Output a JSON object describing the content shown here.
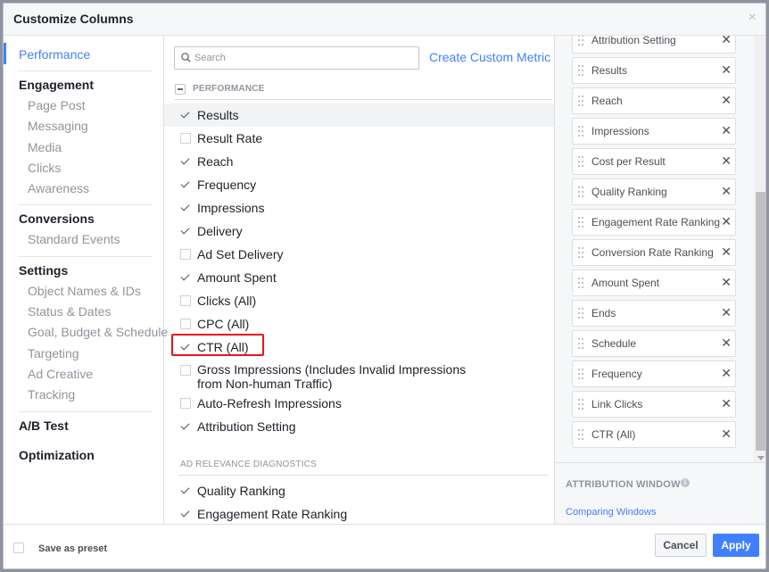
{
  "dialog": {
    "title": "Customize Columns",
    "close_icon": "×"
  },
  "nav": {
    "sections": [
      {
        "label": "Performance",
        "active": true,
        "items": []
      },
      {
        "label": "Engagement",
        "items": [
          "Page Post",
          "Messaging",
          "Media",
          "Clicks",
          "Awareness"
        ]
      },
      {
        "label": "Conversions",
        "items": [
          "Standard Events"
        ]
      },
      {
        "label": "Settings",
        "items": [
          "Object Names & IDs",
          "Status & Dates",
          "Goal, Budget & Schedule",
          "Targeting",
          "Ad Creative",
          "Tracking"
        ]
      },
      {
        "label": "A/B Test",
        "items": []
      },
      {
        "label": "Optimization",
        "items": []
      }
    ]
  },
  "search": {
    "placeholder": "Search",
    "value": ""
  },
  "create_custom_metric": "Create Custom Metric",
  "performance": {
    "heading": "PERFORMANCE",
    "metrics": [
      {
        "label": "Results",
        "checked": true
      },
      {
        "label": "Result Rate",
        "checked": false
      },
      {
        "label": "Reach",
        "checked": true
      },
      {
        "label": "Frequency",
        "checked": true
      },
      {
        "label": "Impressions",
        "checked": true
      },
      {
        "label": "Delivery",
        "checked": true
      },
      {
        "label": "Ad Set Delivery",
        "checked": false
      },
      {
        "label": "Amount Spent",
        "checked": true
      },
      {
        "label": "Clicks (All)",
        "checked": false
      },
      {
        "label": "CPC (All)",
        "checked": false
      },
      {
        "label": "CTR (All)",
        "checked": true
      },
      {
        "label": "Gross Impressions (Includes Invalid Impressions from Non-human Traffic)",
        "checked": false
      },
      {
        "label": "Auto-Refresh Impressions",
        "checked": false
      },
      {
        "label": "Attribution Setting",
        "checked": true
      }
    ]
  },
  "ad_relevance": {
    "heading": "AD RELEVANCE DIAGNOSTICS",
    "metrics": [
      {
        "label": "Quality Ranking",
        "checked": true
      },
      {
        "label": "Engagement Rate Ranking",
        "checked": true
      }
    ]
  },
  "selected_columns": [
    "Attribution Setting",
    "Results",
    "Reach",
    "Impressions",
    "Cost per Result",
    "Quality Ranking",
    "Engagement Rate Ranking",
    "Conversion Rate Ranking",
    "Amount Spent",
    "Ends",
    "Schedule",
    "Frequency",
    "Link Clicks",
    "CTR (All)"
  ],
  "remove_icon": "✕",
  "attribution": {
    "heading": "ATTRIBUTION WINDOW",
    "info_icon": "i",
    "link": "Comparing Windows"
  },
  "footer": {
    "save_preset": "Save as preset",
    "cancel": "Cancel",
    "apply": "Apply"
  },
  "colors": {
    "accent": "#4080ff",
    "highlight_box": "#e9141d"
  }
}
